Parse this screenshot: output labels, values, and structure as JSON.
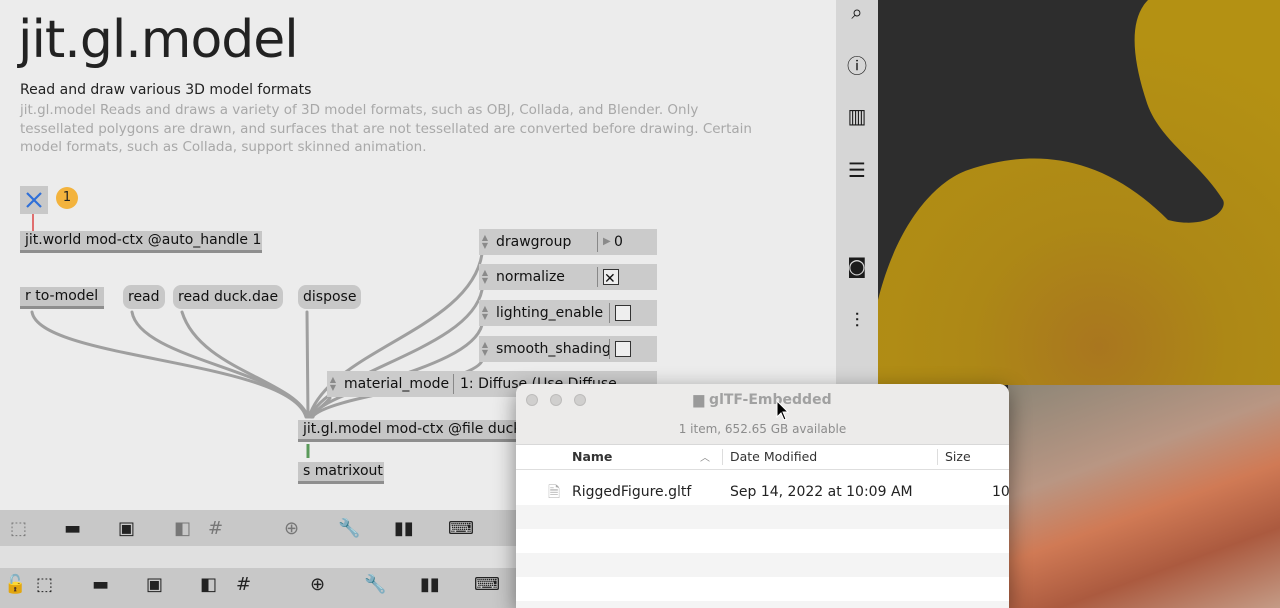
{
  "patcher": {
    "title": "jit.gl.model",
    "subtitle": "Read and draw various 3D model formats",
    "description": "jit.gl.model Reads and draws a variety of 3D model formats, such as OBJ, Collada, and Blender. Only tessellated polygons are drawn, and surfaces that are not tessellated are converted before drawing. Certain model formats, such as Collada, support skinned animation.",
    "badge": "1",
    "objects": {
      "world": "jit.world mod-ctx @auto_handle 1",
      "receive": "r to-model",
      "model": "jit.gl.model mod-ctx @file duck.",
      "send": "s matrixout"
    },
    "messages": {
      "read": "read",
      "read_duck": "read duck.dae",
      "dispose": "dispose"
    },
    "attrs": {
      "drawgroup": {
        "label": "drawgroup",
        "value": "0"
      },
      "normalize": {
        "label": "normalize"
      },
      "lighting_enable": {
        "label": "lighting_enable"
      },
      "smooth_shading": {
        "label": "smooth_shading"
      },
      "material_mode": {
        "label": "material_mode",
        "value": "1: Diffuse (Use Diffuse"
      }
    }
  },
  "finder": {
    "title": "glTF-Embedded",
    "status": "1 item, 652.65 GB available",
    "columns": {
      "name": "Name",
      "date": "Date Modified",
      "size": "Size"
    },
    "files": [
      {
        "name": "RiggedFigure.gltf",
        "date": "Sep 14, 2022 at 10:09 AM",
        "size": "10"
      }
    ]
  },
  "colors": {
    "duck_yellow": "#b08e14",
    "gl_background": "#2d2d2d",
    "patcher_background": "#ececec",
    "toggle_blue": "#2f6fd8",
    "badge_orange": "#f3b33d"
  }
}
